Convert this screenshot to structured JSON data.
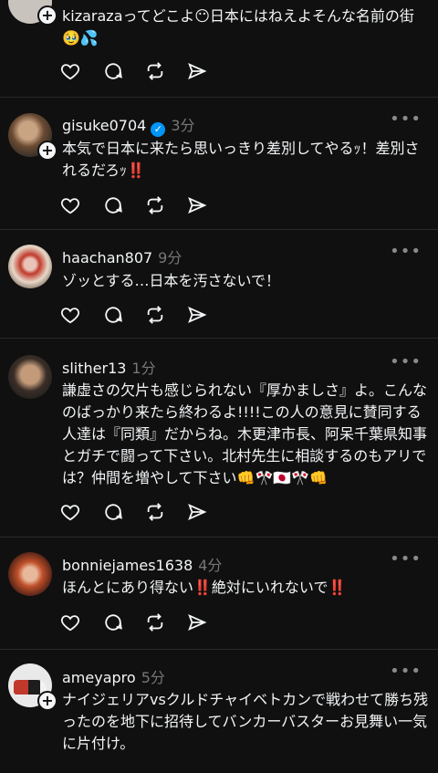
{
  "posts": [
    {
      "username": "",
      "time": "",
      "text": "kizarazaってどこよ😶日本にはねえよそんな名前の街🥹💦",
      "verified": false
    },
    {
      "username": "gisuke0704",
      "time": "3分",
      "text": "本気で日本に来たら思いっきり差別してやるｯ！差別されるだろｯ‼️",
      "verified": true
    },
    {
      "username": "haachan807",
      "time": "9分",
      "text": "ゾッとする…日本を汚さないで！",
      "verified": false
    },
    {
      "username": "slither13",
      "time": "1分",
      "text": "謙虚さの欠片も感じられない『厚かましさ』よ。こんなのばっかり来たら終わるよ!!!!この人の意見に賛同する人達は『同類』だからね。木更津市長、阿呆千葉県知事とガチで闘って下さい。北村先生に相談するのもアリでは？仲間を増やして下さい👊🎌🇯🇵🎌👊",
      "verified": false
    },
    {
      "username": "bonniejames1638",
      "time": "4分",
      "text": "ほんとにあり得ない‼️絶対にいれないで‼️",
      "verified": false
    },
    {
      "username": "ameyapro",
      "time": "5分",
      "text": "ナイジェリアvsクルドチャイベトカンで戦わせて勝ち残ったのを地下に招待してバンカーバスターお見舞い一気に片付け。",
      "verified": false
    }
  ],
  "icons": {
    "like": "heart-icon",
    "reply": "comment-icon",
    "repost": "repost-icon",
    "share": "share-icon",
    "more": "more-icon",
    "follow": "plus-icon",
    "verified": "verified-badge-icon"
  },
  "colors": {
    "background": "#101010",
    "text": "#f3f5f7",
    "muted": "#777777",
    "verified": "#0095f6",
    "divider": "#2a2a2a"
  }
}
